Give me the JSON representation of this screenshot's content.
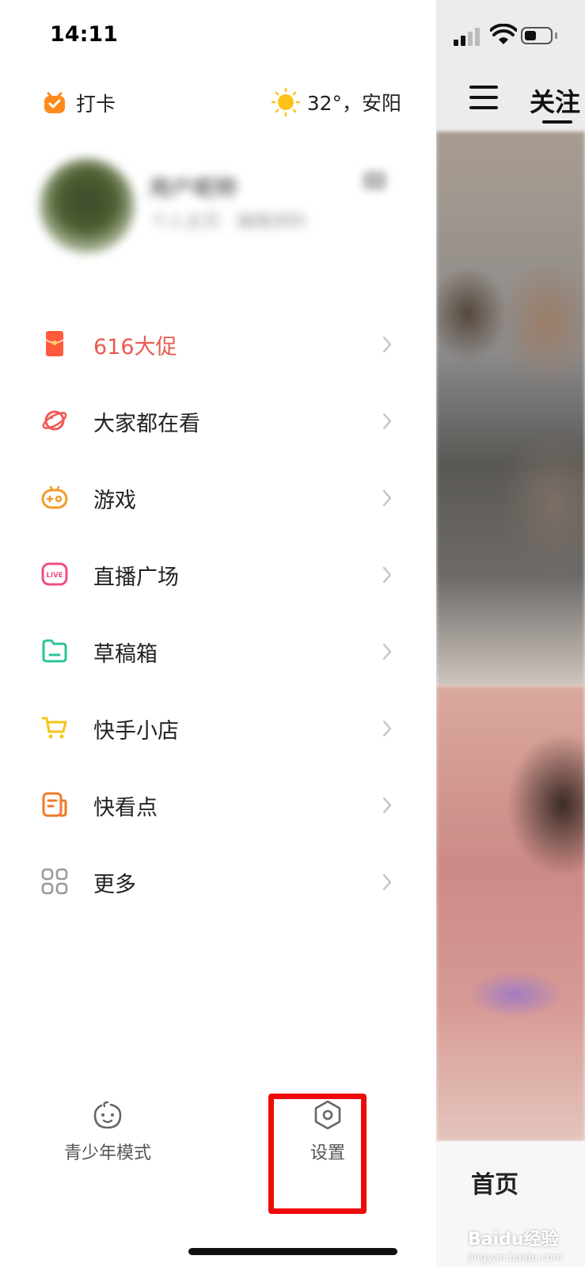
{
  "status_bar": {
    "time": "14:11"
  },
  "drawer": {
    "checkin_label": "打卡",
    "weather": "32°，安阳",
    "profile": {
      "name": "用户昵称",
      "subtitle": "个人主页 · 编辑资料"
    },
    "menu": [
      {
        "label": "616大促",
        "icon": "red-envelope-icon",
        "color": "#ff5a3c"
      },
      {
        "label": "大家都在看",
        "icon": "planet-icon",
        "color": "#ef5b5b"
      },
      {
        "label": "游戏",
        "icon": "gamepad-icon",
        "color": "#f39a2b"
      },
      {
        "label": "直播广场",
        "icon": "live-icon",
        "color": "#ec4e87"
      },
      {
        "label": "草稿箱",
        "icon": "folder-icon",
        "color": "#2ec39b"
      },
      {
        "label": "快手小店",
        "icon": "cart-icon",
        "color": "#f5c518"
      },
      {
        "label": "快看点",
        "icon": "news-icon",
        "color": "#f07a2a"
      },
      {
        "label": "更多",
        "icon": "grid-icon",
        "color": "#999999"
      }
    ],
    "bottom": {
      "youth_mode": "青少年模式",
      "settings": "设置"
    }
  },
  "main": {
    "top_tab": "关注",
    "bottom_tab": "首页",
    "watermark": "Baidu经验",
    "watermark_url": "jingyan.baidu.com"
  },
  "colors": {
    "highlight": "#ee0a0a",
    "promo_text": "#e85a4f",
    "accent_orange": "#ff8a1a"
  }
}
